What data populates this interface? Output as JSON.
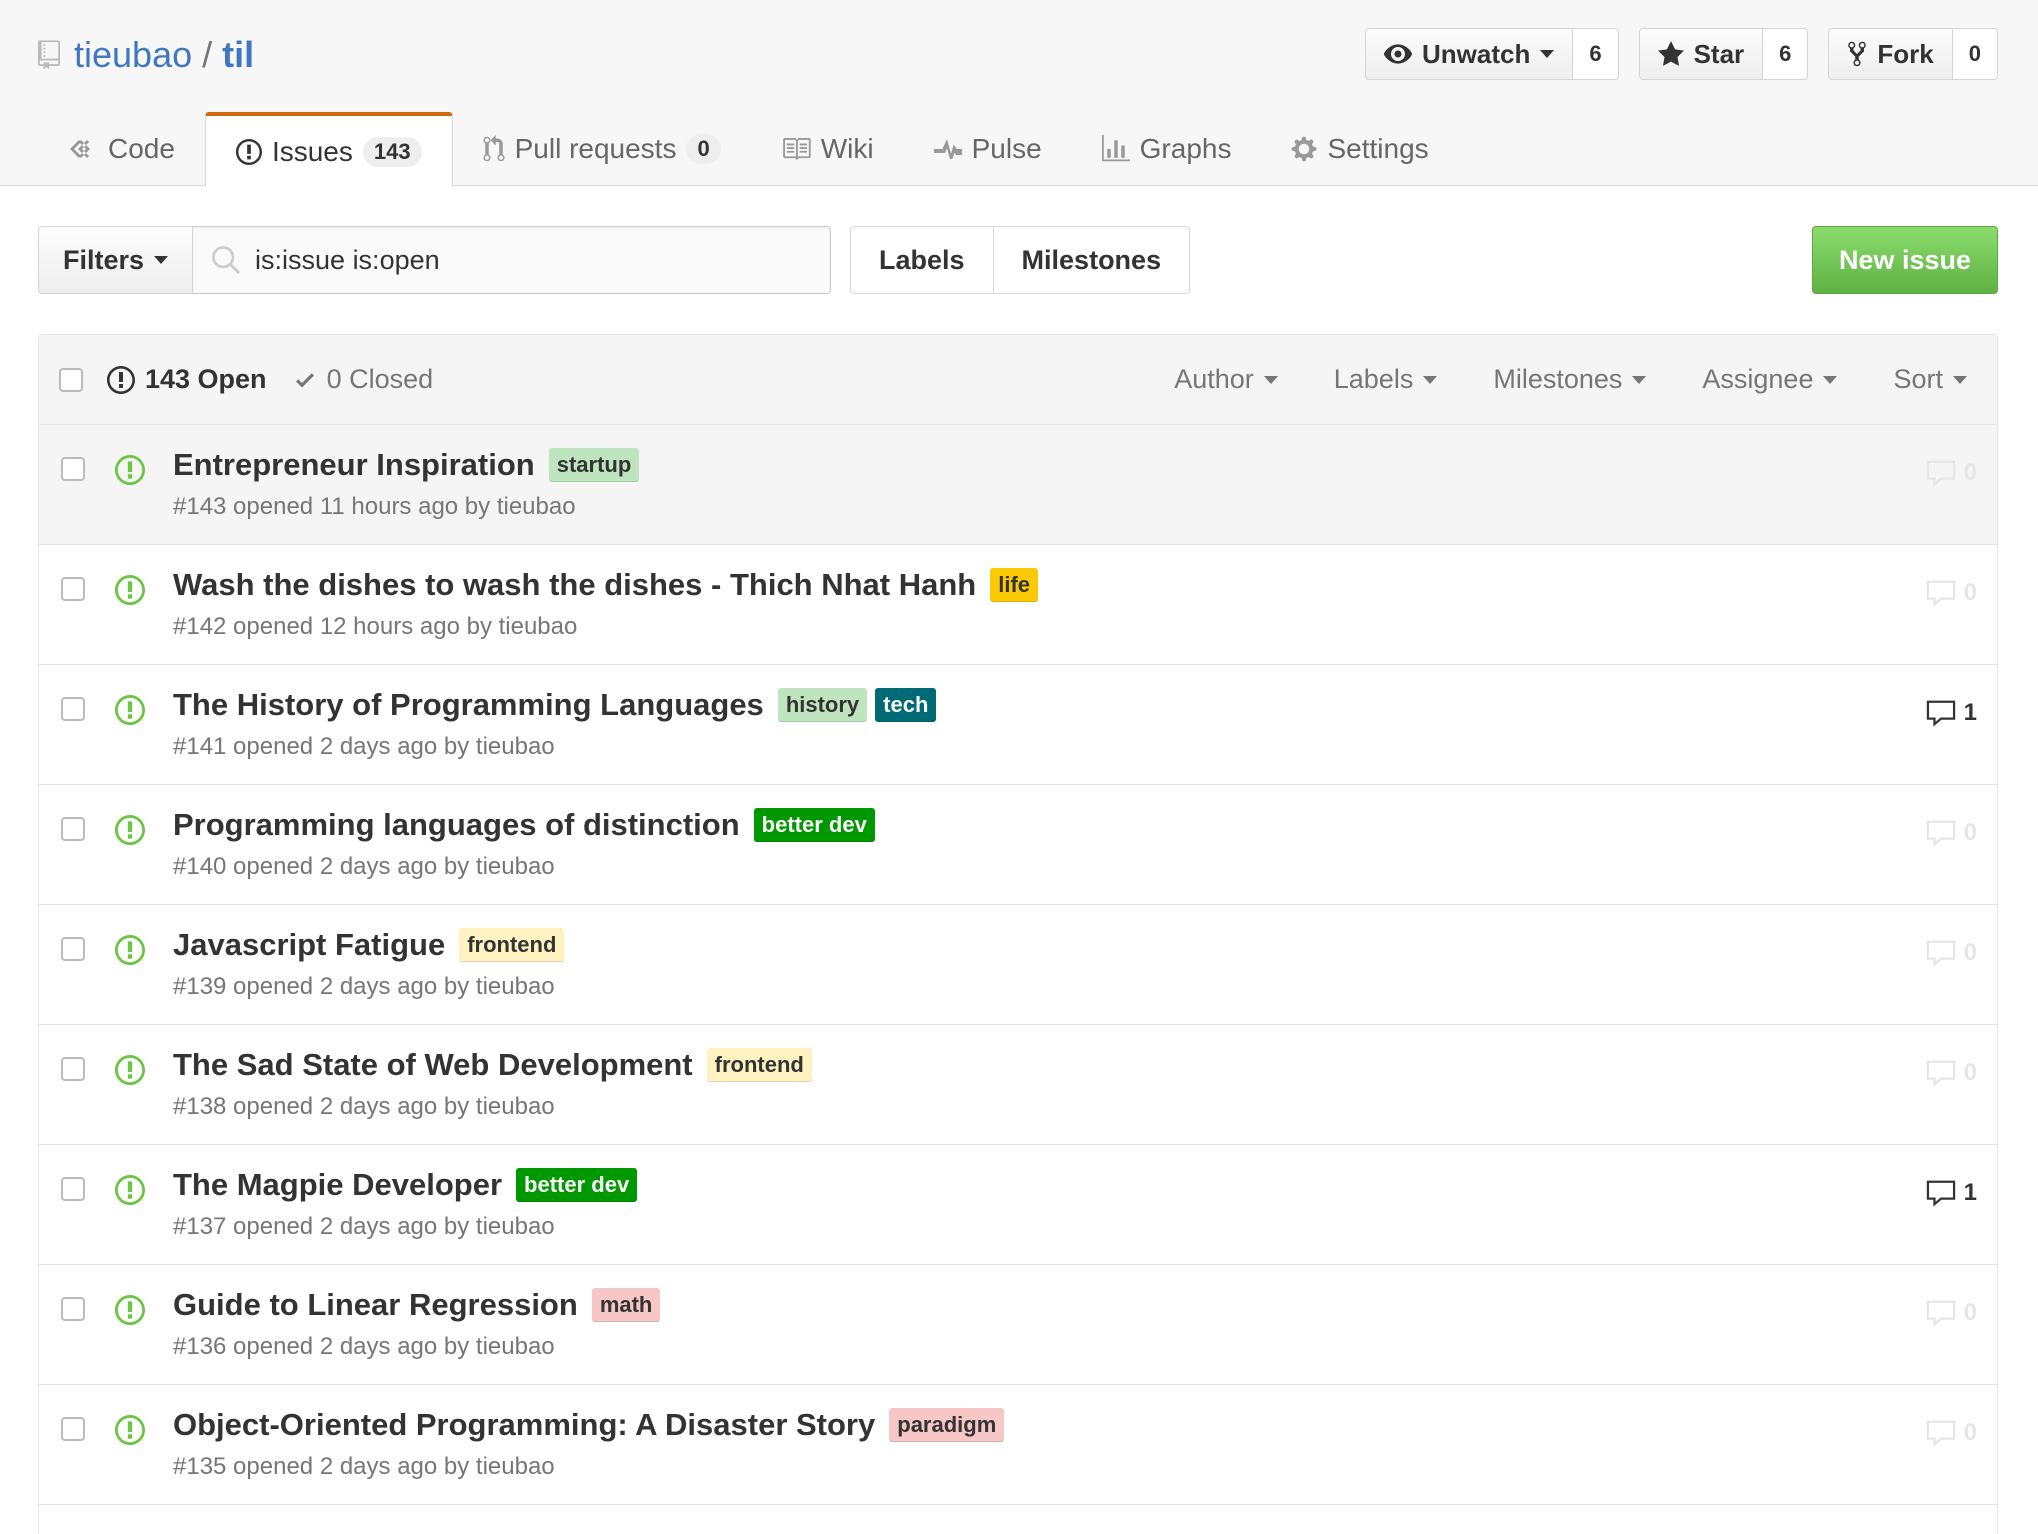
{
  "repo": {
    "owner": "tieubao",
    "separator": "/",
    "name": "til"
  },
  "actions": {
    "watch": {
      "label": "Unwatch",
      "count": "6"
    },
    "star": {
      "label": "Star",
      "count": "6"
    },
    "fork": {
      "label": "Fork",
      "count": "0"
    }
  },
  "nav": {
    "code": "Code",
    "issues": "Issues",
    "issues_count": "143",
    "pulls": "Pull requests",
    "pulls_count": "0",
    "wiki": "Wiki",
    "pulse": "Pulse",
    "graphs": "Graphs",
    "settings": "Settings"
  },
  "subnav": {
    "filters": "Filters",
    "search_value": "is:issue is:open",
    "labels": "Labels",
    "milestones": "Milestones",
    "new_issue": "New issue"
  },
  "listing": {
    "open": "143 Open",
    "closed": "0 Closed",
    "author": "Author",
    "labels": "Labels",
    "milestones": "Milestones",
    "assignee": "Assignee",
    "sort": "Sort"
  },
  "colors": {
    "accent": "#4078c0",
    "open_icon": "#6cc644",
    "tab_border": "#d26911",
    "new_issue": "#60b044"
  },
  "issues": [
    {
      "title": "Entrepreneur Inspiration",
      "labels": [
        {
          "text": "startup",
          "bg": "#bfe5bf",
          "fg": "#333"
        }
      ],
      "meta": "#143 opened 11 hours ago by tieubao",
      "comments": "0",
      "hover": true
    },
    {
      "title": "Wash the dishes to wash the dishes - Thich Nhat Hanh",
      "labels": [
        {
          "text": "life",
          "bg": "#fbca04",
          "fg": "#333"
        }
      ],
      "meta": "#142 opened 12 hours ago by tieubao",
      "comments": "0"
    },
    {
      "title": "The History of Programming Languages",
      "labels": [
        {
          "text": "history",
          "bg": "#bfe5bf",
          "fg": "#333"
        },
        {
          "text": "tech",
          "bg": "#006b75",
          "fg": "#fff"
        }
      ],
      "meta": "#141 opened 2 days ago by tieubao",
      "comments": "1"
    },
    {
      "title": "Programming languages of distinction",
      "labels": [
        {
          "text": "better dev",
          "bg": "#009800",
          "fg": "#fff"
        }
      ],
      "meta": "#140 opened 2 days ago by tieubao",
      "comments": "0"
    },
    {
      "title": "Javascript Fatigue",
      "labels": [
        {
          "text": "frontend",
          "bg": "#fef2c0",
          "fg": "#333"
        }
      ],
      "meta": "#139 opened 2 days ago by tieubao",
      "comments": "0"
    },
    {
      "title": "The Sad State of Web Development",
      "labels": [
        {
          "text": "frontend",
          "bg": "#fef2c0",
          "fg": "#333"
        }
      ],
      "meta": "#138 opened 2 days ago by tieubao",
      "comments": "0"
    },
    {
      "title": "The Magpie Developer",
      "labels": [
        {
          "text": "better dev",
          "bg": "#009800",
          "fg": "#fff"
        }
      ],
      "meta": "#137 opened 2 days ago by tieubao",
      "comments": "1"
    },
    {
      "title": "Guide to Linear Regression",
      "labels": [
        {
          "text": "math",
          "bg": "#f7c6c7",
          "fg": "#333"
        }
      ],
      "meta": "#136 opened 2 days ago by tieubao",
      "comments": "0"
    },
    {
      "title": "Object-Oriented Programming: A Disaster Story",
      "labels": [
        {
          "text": "paradigm",
          "bg": "#f7c6c7",
          "fg": "#333"
        }
      ],
      "meta": "#135 opened 2 days ago by tieubao",
      "comments": "0"
    }
  ]
}
